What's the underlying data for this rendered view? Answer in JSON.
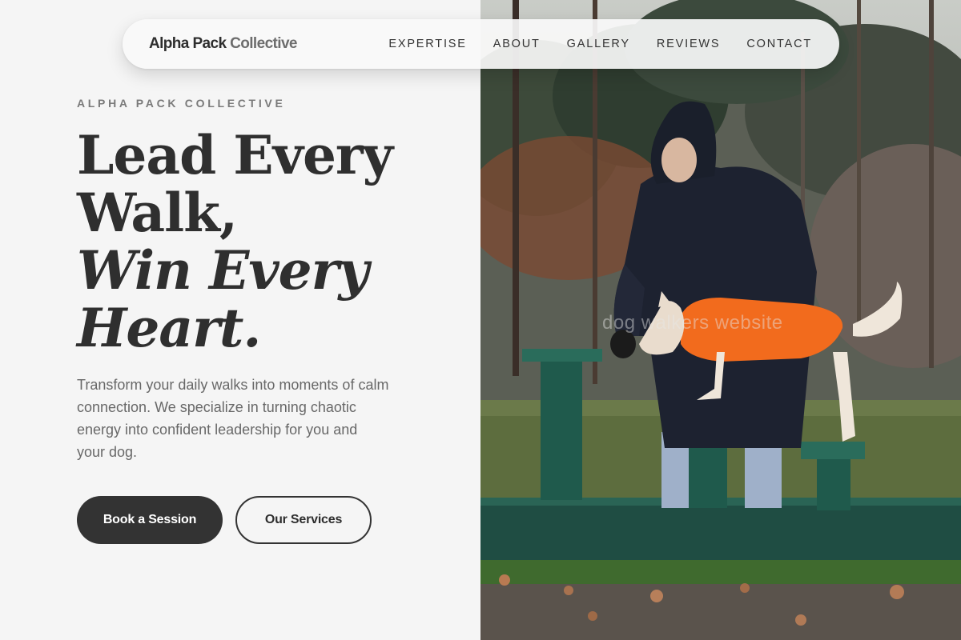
{
  "brand": {
    "name_a": "Alpha Pack",
    "name_b": " Collective"
  },
  "nav": {
    "items": [
      "EXPERTISE",
      "ABOUT",
      "GALLERY",
      "REVIEWS",
      "CONTACT"
    ]
  },
  "hero": {
    "eyebrow": "ALPHA PACK COLLECTIVE",
    "headline_line1": "Lead Every",
    "headline_line2": "Walk,",
    "headline_line3": "Win Every",
    "headline_line4": "Heart.",
    "description": "Transform your daily walks into moments of calm connection. We specialize in turning chaotic energy into confident leadership for you and your dog.",
    "primary_cta": "Book a Session",
    "secondary_cta": "Our Services"
  },
  "photo": {
    "watermark": "dog walkers website"
  },
  "colors": {
    "background": "#f5f5f5",
    "text_dark": "#2f2f2f",
    "text_muted": "#686868",
    "button_dark": "#333333",
    "dog_coat": "#f26b1d",
    "fence_green": "#1f5a4c"
  }
}
